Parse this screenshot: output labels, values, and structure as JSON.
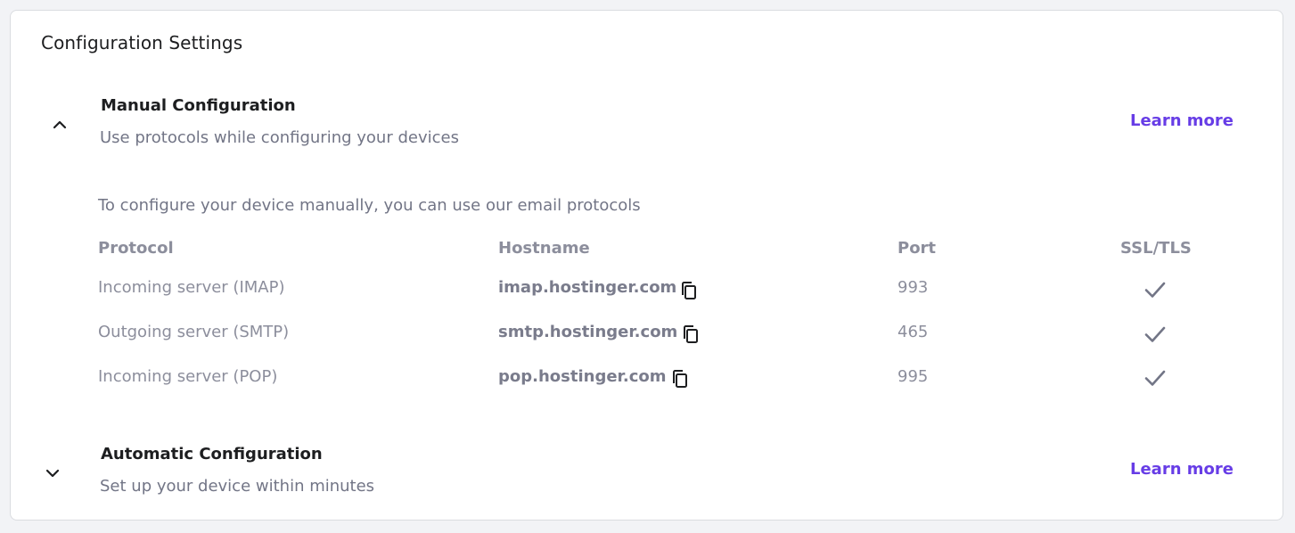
{
  "card": {
    "title": "Configuration Settings"
  },
  "manual": {
    "title": "Manual Configuration",
    "subtitle": "Use protocols while configuring your devices",
    "learn_more": "Learn more",
    "expanded": true,
    "intro": "To configure your device manually, you can use our email protocols",
    "columns": [
      "Protocol",
      "Hostname",
      "Port",
      "SSL/TLS"
    ],
    "rows": [
      {
        "protocol": "Incoming server (IMAP)",
        "hostname": "imap.hostinger.com",
        "port": "993",
        "ssl": true
      },
      {
        "protocol": "Outgoing server (SMTP)",
        "hostname": "smtp.hostinger.com",
        "port": "465",
        "ssl": true
      },
      {
        "protocol": "Incoming server (POP)",
        "hostname": "pop.hostinger.com",
        "port": "995",
        "ssl": true
      }
    ]
  },
  "automatic": {
    "title": "Automatic Configuration",
    "subtitle": "Set up your device within minutes",
    "learn_more": "Learn more",
    "expanded": false
  },
  "colors": {
    "accent": "#673de6",
    "text_dark": "#1d1e20",
    "text_muted": "#727586"
  },
  "icons": {
    "collapse": "chevron-up-icon",
    "expand": "chevron-down-icon",
    "copy": "copy-icon",
    "ssl": "check-icon"
  }
}
